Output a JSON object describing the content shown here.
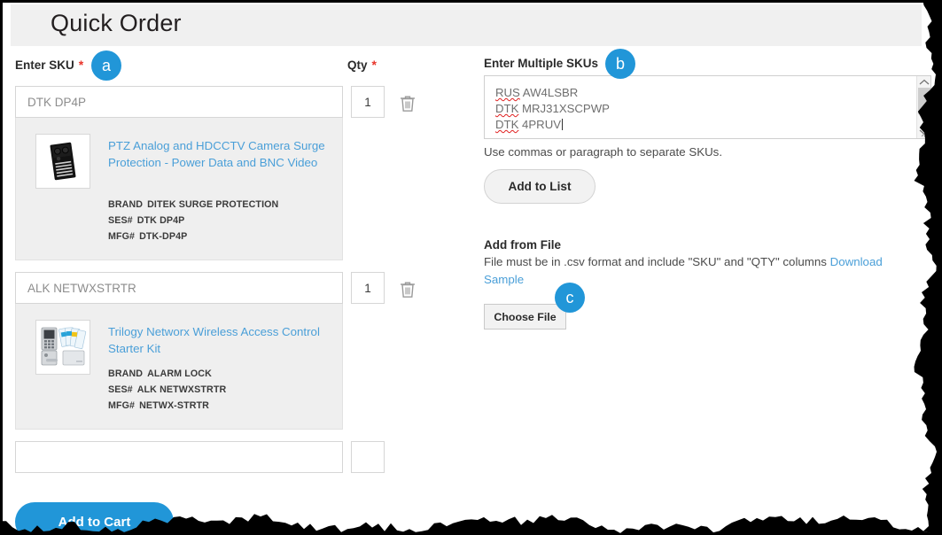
{
  "header": {
    "title": "Quick Order"
  },
  "left": {
    "sku_label": "Enter SKU",
    "qty_label": "Qty",
    "required_mark": "*",
    "badge_a": "a",
    "rows": [
      {
        "sku_value": "DTK DP4P",
        "qty_value": "1",
        "product": {
          "title": "PTZ Analog and HDCCTV Camera Surge Protection - Power Data and BNC Video",
          "brand_key": "BRAND",
          "brand_value": "DITEK SURGE PROTECTION",
          "ses_key": "SES#",
          "ses_value": "DTK DP4P",
          "mfg_key": "MFG#",
          "mfg_value": "DTK-DP4P",
          "thumb_icon": "surge-protector-thumbnail"
        }
      },
      {
        "sku_value": "ALK NETWXSTRTR",
        "qty_value": "1",
        "product": {
          "title": "Trilogy Networx Wireless Access Control Starter Kit",
          "brand_key": "BRAND",
          "brand_value": "ALARM LOCK",
          "ses_key": "SES#",
          "ses_value": "ALK NETWXSTRTR",
          "mfg_key": "MFG#",
          "mfg_value": "NETWX-STRTR",
          "thumb_icon": "door-lock-keypad-thumbnail"
        }
      },
      {
        "sku_value": "",
        "qty_value": ""
      }
    ],
    "add_to_cart_label": "Add to Cart",
    "delete_icon": "trash-icon"
  },
  "right": {
    "multi_label": "Enter Multiple SKUs",
    "badge_b": "b",
    "badge_c": "c",
    "textarea_lines": [
      {
        "prefix": "RUS",
        "rest": "AW4LSBR"
      },
      {
        "prefix": "DTK",
        "rest": "MRJ31XSCPWP"
      },
      {
        "prefix": "DTK",
        "rest": "4PRUV"
      }
    ],
    "textarea_hint": "Use commas or paragraph to separate SKUs.",
    "add_to_list_label": "Add to List",
    "add_from_file_heading": "Add from File",
    "file_desc_text": "File must be in .csv format and include \"SKU\" and \"QTY\" columns ",
    "download_sample_link": "Download Sample",
    "choose_file_label": "Choose File"
  },
  "colors": {
    "accent_blue": "#2196d8",
    "link_blue": "#4a9fd8",
    "required_red": "#e8342a",
    "panel_gray": "#efefef",
    "header_gray": "#f0f0f0"
  }
}
